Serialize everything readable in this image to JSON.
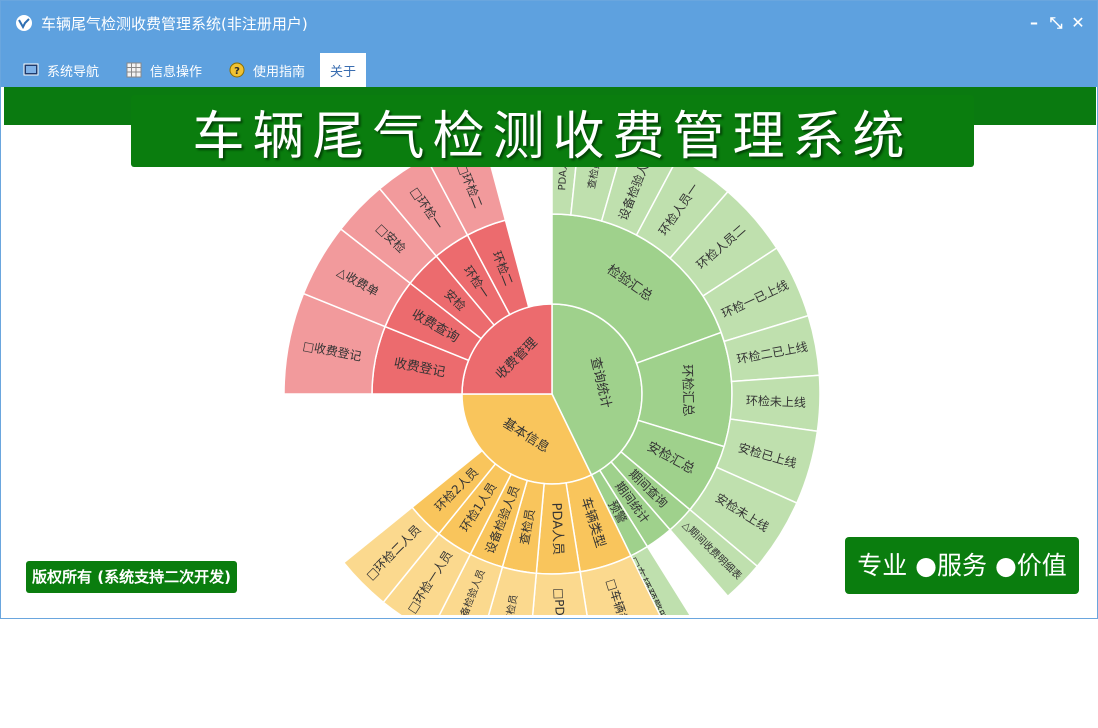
{
  "window": {
    "title": "车辆尾气检测收费管理系统(非注册用户)",
    "controls": {
      "minimize": "–",
      "restore": "⤡",
      "close": "✕"
    }
  },
  "menu": [
    {
      "label": "系统导航",
      "icon": "monitor-icon"
    },
    {
      "label": "信息操作",
      "icon": "grid-icon"
    },
    {
      "label": "使用指南",
      "icon": "help-icon"
    },
    {
      "label": "关于",
      "icon": ""
    }
  ],
  "banner": {
    "title": "车辆尾气检测收费管理系统"
  },
  "footer": {
    "copyright": "版权所有 (系统支持二次开发)",
    "slogan": "专业 ●服务 ●价值"
  },
  "colors": {
    "titlebar": "#5ea1df",
    "banner": "#0a7d0e",
    "query_stats": "#9fd18c",
    "fee_mgmt": "#ec6b6e",
    "basic_info": "#f9c55c"
  },
  "sunburst": {
    "groups": [
      {
        "name": "查询统计",
        "color": "#9fd18c",
        "lightColor": "#bfe0ae",
        "children": [
          {
            "name": "检验汇总",
            "leaves": [
              "PDA人员",
              "查检员",
              "设备检验人员",
              "环检人员一",
              "环检人员二"
            ]
          },
          {
            "name": "环检汇总",
            "leaves": [
              "环检一已上线",
              "环检二已上线",
              "环检未上线"
            ]
          },
          {
            "name": "安检汇总",
            "leaves": [
              "安检已上线",
              "安检未上线"
            ]
          },
          {
            "name": "期间查询",
            "leaves": [
              "△期间收费明细表"
            ]
          },
          {
            "name": "期间统计",
            "leaves": []
          },
          {
            "name": "预警",
            "leaves": [
              "□车辆预警明细"
            ]
          }
        ]
      },
      {
        "name": "基本信息",
        "color": "#f9c55c",
        "lightColor": "#fbd98e",
        "children": [
          {
            "name": "车辆类型",
            "leaves": [
              "□车辆类型"
            ]
          },
          {
            "name": "PDA人员",
            "leaves": [
              "□PDA人员"
            ]
          },
          {
            "name": "查检员",
            "leaves": [
              "□查检员"
            ]
          },
          {
            "name": "设备检验人员",
            "leaves": [
              "□设备检验人员"
            ]
          },
          {
            "name": "环检1人员",
            "leaves": [
              "□环检一人员"
            ]
          },
          {
            "name": "环检2人员",
            "leaves": [
              "□环检二人员"
            ]
          }
        ]
      },
      {
        "name": "收费管理",
        "color": "#ec6b6e",
        "lightColor": "#f29a9c",
        "children": [
          {
            "name": "收费登记",
            "leaves": [
              "□收费登记"
            ]
          },
          {
            "name": "收费查询",
            "leaves": [
              "△收费单"
            ]
          },
          {
            "name": "安检",
            "leaves": [
              "□安检"
            ]
          },
          {
            "name": "环检一",
            "leaves": [
              "□环检一"
            ]
          },
          {
            "name": "环检二",
            "leaves": [
              "□环检二"
            ]
          }
        ]
      }
    ]
  }
}
